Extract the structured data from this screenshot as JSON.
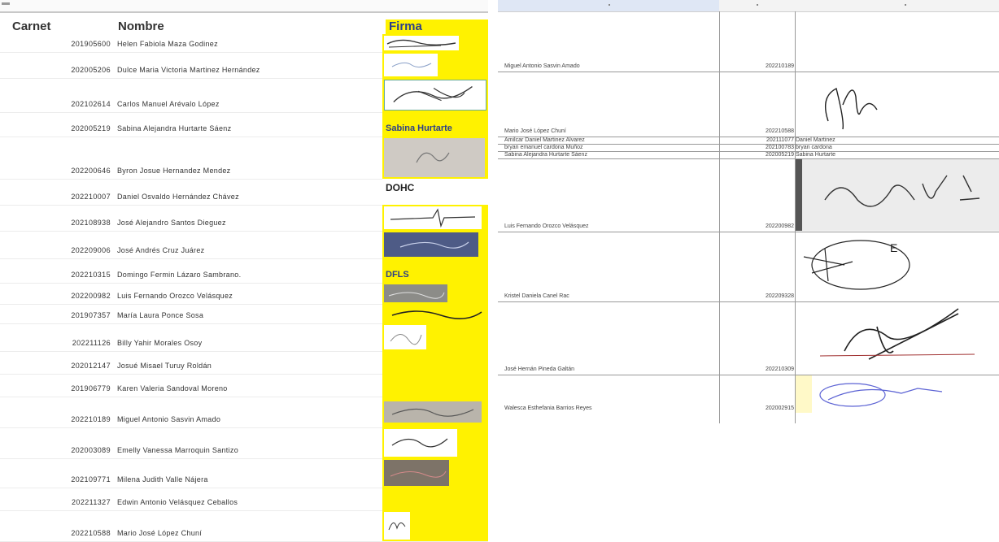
{
  "left_table": {
    "headers": {
      "carnet": "Carnet",
      "nombre": "Nombre",
      "firma": "Firma"
    },
    "rows": [
      {
        "carnet": "201905600",
        "nombre": "Helen Fabiola Maza Godinez",
        "firma_text": ""
      },
      {
        "carnet": "202005206",
        "nombre": "Dulce Maria Victoria Martinez Hernández",
        "firma_text": ""
      },
      {
        "carnet": "202102614",
        "nombre": "Carlos Manuel Arévalo López",
        "firma_text": ""
      },
      {
        "carnet": "202005219",
        "nombre": "Sabina Alejandra Hurtarte Sáenz",
        "firma_text": "Sabina Hurtarte"
      },
      {
        "carnet": "202200646",
        "nombre": "Byron Josue Hernandez Mendez",
        "firma_text": ""
      },
      {
        "carnet": "202210007",
        "nombre": "Daniel Osvaldo Hernández Chávez",
        "firma_text": "DOHC"
      },
      {
        "carnet": "202108938",
        "nombre": "José Alejandro Santos Dieguez",
        "firma_text": ""
      },
      {
        "carnet": "202209006",
        "nombre": "José Andrés Cruz Juárez",
        "firma_text": ""
      },
      {
        "carnet": "202210315",
        "nombre": "Domingo Fermin Lázaro Sambrano.",
        "firma_text": "DFLS"
      },
      {
        "carnet": "202200982",
        "nombre": "Luis Fernando Orozco Velásquez",
        "firma_text": ""
      },
      {
        "carnet": "201907357",
        "nombre": "María Laura Ponce Sosa",
        "firma_text": ""
      },
      {
        "carnet": "202211126",
        "nombre": "Billy Yahir Morales Osoy",
        "firma_text": ""
      },
      {
        "carnet": "202012147",
        "nombre": "Josué Misael Turuy Roldán",
        "firma_text": ""
      },
      {
        "carnet": "201906779",
        "nombre": "Karen Valeria Sandoval Moreno",
        "firma_text": ""
      },
      {
        "carnet": "202210189",
        "nombre": "Miguel Antonio Sasvin Amado",
        "firma_text": ""
      },
      {
        "carnet": "202003089",
        "nombre": "Emelly Vanessa Marroquin Santizo",
        "firma_text": ""
      },
      {
        "carnet": "202109771",
        "nombre": "Milena Judith Valle Nájera",
        "firma_text": ""
      },
      {
        "carnet": "202211327",
        "nombre": "Edwin Antonio Velásquez Ceballos",
        "firma_text": ""
      },
      {
        "carnet": "202210588",
        "nombre": "Mario José López Chuní",
        "firma_text": ""
      }
    ]
  },
  "right_table": {
    "rows": [
      {
        "nombre": "Miguel Antonio Sasvin Amado",
        "carnet": "202210189",
        "firma_text": ""
      },
      {
        "nombre": "Mario José López Chuní",
        "carnet": "202210588",
        "firma_text": ""
      },
      {
        "nombre": "Amilcar Daniel Martinez Alvarez",
        "carnet": "202111077",
        "firma_text": "Daniel Martinez"
      },
      {
        "nombre": "bryan emanuel cardona Muñoz",
        "carnet": "202100783",
        "firma_text": "bryan cardona"
      },
      {
        "nombre": "Sabina Alejandra Hurtarte Sáenz",
        "carnet": "202005219",
        "firma_text": "Sabina Hurtarte"
      },
      {
        "nombre": "Luis Fernando Orozco Velásquez",
        "carnet": "202200982",
        "firma_text": ""
      },
      {
        "nombre": "Kristel Daniela Canel Rac",
        "carnet": "202209328",
        "firma_text": ""
      },
      {
        "nombre": "José Hernán Pineda Galtán",
        "carnet": "202210309",
        "firma_text": ""
      },
      {
        "nombre": "Walesca Esthefania Barrios Reyes",
        "carnet": "202002915",
        "firma_text": ""
      }
    ]
  }
}
